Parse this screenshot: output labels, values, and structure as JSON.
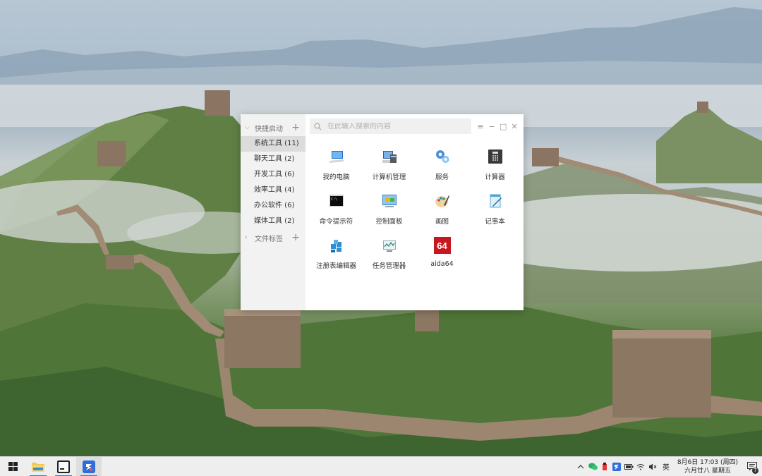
{
  "launcher": {
    "groups": [
      {
        "label": "快捷启动",
        "expanded": true,
        "categories": [
          {
            "label": "系统工具 (11)",
            "active": true
          },
          {
            "label": "聊天工具 (2)"
          },
          {
            "label": "开发工具 (6)"
          },
          {
            "label": "效率工具 (4)"
          },
          {
            "label": "办公软件 (6)"
          },
          {
            "label": "媒体工具 (2)"
          }
        ]
      },
      {
        "label": "文件标签",
        "expanded": false
      }
    ],
    "add_symbol": "+",
    "search": {
      "placeholder": "在此输入搜索的内容",
      "value": ""
    },
    "window_controls": {
      "menu": "≡",
      "minimize": "−",
      "maximize": "□",
      "close": "✕"
    },
    "apps": [
      {
        "label": "我的电脑",
        "icon": "computer-icon"
      },
      {
        "label": "计算机管理",
        "icon": "computer-management-icon"
      },
      {
        "label": "服务",
        "icon": "services-gears-icon"
      },
      {
        "label": "计算器",
        "icon": "calculator-icon"
      },
      {
        "label": "命令提示符",
        "icon": "command-prompt-icon"
      },
      {
        "label": "控制面板",
        "icon": "control-panel-icon"
      },
      {
        "label": "画图",
        "icon": "paint-palette-icon"
      },
      {
        "label": "记事本",
        "icon": "notepad-icon"
      },
      {
        "label": "注册表编辑器",
        "icon": "registry-editor-icon"
      },
      {
        "label": "任务管理器",
        "icon": "task-manager-icon"
      },
      {
        "label": "aida64",
        "icon": "aida64-icon",
        "icon_text": "64"
      }
    ]
  },
  "taskbar": {
    "buttons": [
      {
        "name": "start-button",
        "icon": "windows-logo-icon"
      },
      {
        "name": "file-explorer-button",
        "icon": "folder-icon"
      },
      {
        "name": "terminal-button",
        "icon": "terminal-icon"
      },
      {
        "name": "launcher-app-button",
        "icon": "launcher-app-icon"
      }
    ],
    "tray": {
      "ime": "英",
      "date_line": "8月6日 17:03 (周四)",
      "lunar_line": "六月廿八 星期五",
      "notification_count": "7"
    }
  },
  "colors": {
    "sidebar_bg": "#f2f2f2",
    "active_category": "#dcdcdc",
    "taskbar_bg": "#eeeeee",
    "accent": "#3b78c4",
    "aida_red": "#c8171e"
  }
}
